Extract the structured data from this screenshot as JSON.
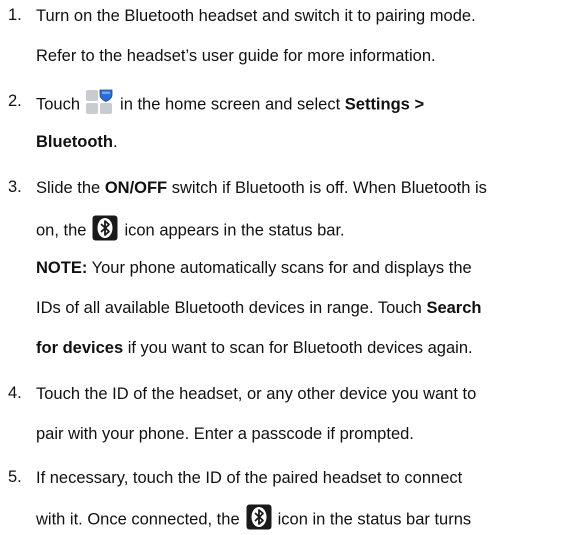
{
  "steps": [
    {
      "number": "1.",
      "lines": {
        "l1": "Turn on the Bluetooth headset and switch it to pairing mode.",
        "l2": "Refer to the headset’s user guide for more information."
      }
    },
    {
      "number": "2.",
      "lines": {
        "l1_pre": "Touch",
        "l1_post": "in the home screen and select",
        "l1_bold": "Settings >",
        "l2_bold": "Bluetooth",
        "l2_post": "."
      }
    },
    {
      "number": "3.",
      "lines": {
        "l1_pre": "Slide the",
        "l1_bold": "ON/OFF",
        "l1_post": "switch if Bluetooth is off. When Bluetooth is",
        "l2_pre": "on, the",
        "l2_post": "icon appears in the status bar.",
        "note_label": "NOTE:",
        "note_l1": "Your phone automatically scans for and displays the",
        "note_l2_pre": "IDs of all available Bluetooth devices in range. Touch",
        "note_l2_bold": "Search",
        "note_l3_bold": "for devices",
        "note_l3_post": "if you want to scan for Bluetooth devices again."
      }
    },
    {
      "number": "4.",
      "lines": {
        "l1": "Touch the ID of the headset, or any other device you want to",
        "l2": "pair with your phone. Enter a passcode if prompted."
      }
    },
    {
      "number": "5.",
      "lines": {
        "l1": "If necessary, touch the ID of the paired headset to connect",
        "l2_pre": "with it. Once connected, the",
        "l2_post": "icon in the status bar turns"
      }
    }
  ],
  "icons": {
    "home": "home-screen-apps-icon",
    "bluetooth": "bluetooth-status-icon"
  }
}
